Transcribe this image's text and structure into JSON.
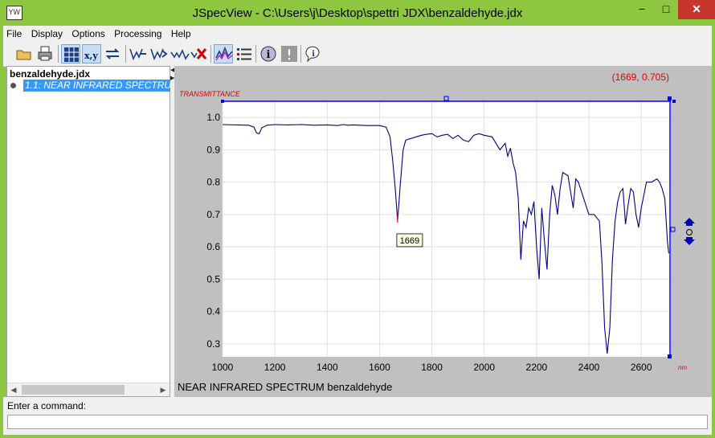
{
  "window": {
    "title": "JSpecView - C:\\Users\\j\\Desktop\\spettri JDX\\benzaldehyde.jdx",
    "app_icon_text": "YW",
    "minimize_glyph": "−",
    "maximize_glyph": "□",
    "close_glyph": "✕"
  },
  "menu": [
    "File",
    "Display",
    "Options",
    "Processing",
    "Help"
  ],
  "toolbar": {
    "icons": [
      "open-folder-icon",
      "print-icon",
      "grid-icon",
      "coordinates-icon",
      "reverse-plot-icon",
      "previous-view-icon",
      "next-view-icon",
      "reset-view-icon",
      "clear-views-icon",
      "overlay-spectra-icon",
      "integration-list-icon",
      "header-info-icon",
      "exclamation-icon",
      "about-icon"
    ],
    "coordinates_label": "x,y"
  },
  "tree": {
    "root": "benzaldehyde.jdx",
    "child": "1.1: NEAR INFRARED SPECTRUM benzaldehyde"
  },
  "command": {
    "label": "Enter a command:",
    "value": ""
  },
  "colors": {
    "titlebar": "#8dc63f",
    "plot_background": "#c0c0c0",
    "axis_blue": "#0000ff",
    "spectrum": "#000080",
    "grid": "#e0e0e0",
    "annotation_red": "#e00000"
  },
  "chart_data": {
    "type": "line",
    "title": "NEAR INFRARED SPECTRUM benzaldehyde",
    "ylabel": "TRANSMITTANCE",
    "xlabel": "nm",
    "xlim": [
      1000,
      2710
    ],
    "ylim": [
      0.26,
      1.05
    ],
    "x_ticks": [
      1000,
      1200,
      1400,
      1600,
      1800,
      2000,
      2200,
      2400,
      2600
    ],
    "y_ticks": [
      0.3,
      0.4,
      0.5,
      0.6,
      0.7,
      0.8,
      0.9,
      1.0
    ],
    "grid": true,
    "cursor_readout": "(1669, 0.705)",
    "peak_marker": {
      "x": 1669,
      "y": 0.68,
      "label": "1669"
    },
    "series": [
      {
        "x": [
          1000,
          1100,
          1120,
          1130,
          1140,
          1150,
          1170,
          1200,
          1250,
          1300,
          1350,
          1400,
          1440,
          1460,
          1480,
          1500,
          1550,
          1600,
          1625,
          1640,
          1650,
          1660,
          1669,
          1680,
          1690,
          1700,
          1720,
          1740,
          1760,
          1780,
          1800,
          1820,
          1840,
          1860,
          1880,
          1900,
          1920,
          1940,
          1960,
          1980,
          2000,
          2030,
          2060,
          2080,
          2090,
          2100,
          2110,
          2120,
          2130,
          2140,
          2150,
          2160,
          2170,
          2180,
          2190,
          2200,
          2210,
          2220,
          2230,
          2240,
          2250,
          2260,
          2270,
          2280,
          2290,
          2300,
          2320,
          2340,
          2350,
          2360,
          2380,
          2400,
          2420,
          2440,
          2450,
          2460,
          2470,
          2480,
          2490,
          2500,
          2510,
          2520,
          2530,
          2540,
          2550,
          2560,
          2570,
          2580,
          2590,
          2600,
          2620,
          2640,
          2660,
          2670,
          2680,
          2690,
          2700,
          2705
        ],
        "y": [
          0.978,
          0.976,
          0.97,
          0.952,
          0.95,
          0.968,
          0.976,
          0.978,
          0.977,
          0.978,
          0.976,
          0.977,
          0.975,
          0.978,
          0.976,
          0.977,
          0.975,
          0.975,
          0.97,
          0.94,
          0.87,
          0.78,
          0.68,
          0.8,
          0.9,
          0.93,
          0.935,
          0.94,
          0.945,
          0.948,
          0.95,
          0.94,
          0.945,
          0.948,
          0.935,
          0.945,
          0.93,
          0.925,
          0.945,
          0.95,
          0.945,
          0.94,
          0.9,
          0.92,
          0.88,
          0.905,
          0.86,
          0.83,
          0.75,
          0.56,
          0.68,
          0.66,
          0.72,
          0.7,
          0.74,
          0.6,
          0.5,
          0.72,
          0.62,
          0.53,
          0.7,
          0.79,
          0.76,
          0.7,
          0.78,
          0.83,
          0.82,
          0.72,
          0.81,
          0.8,
          0.75,
          0.7,
          0.7,
          0.68,
          0.55,
          0.35,
          0.27,
          0.35,
          0.56,
          0.68,
          0.74,
          0.77,
          0.78,
          0.67,
          0.73,
          0.78,
          0.77,
          0.7,
          0.66,
          0.72,
          0.8,
          0.8,
          0.81,
          0.8,
          0.78,
          0.75,
          0.62,
          0.58
        ]
      }
    ]
  }
}
